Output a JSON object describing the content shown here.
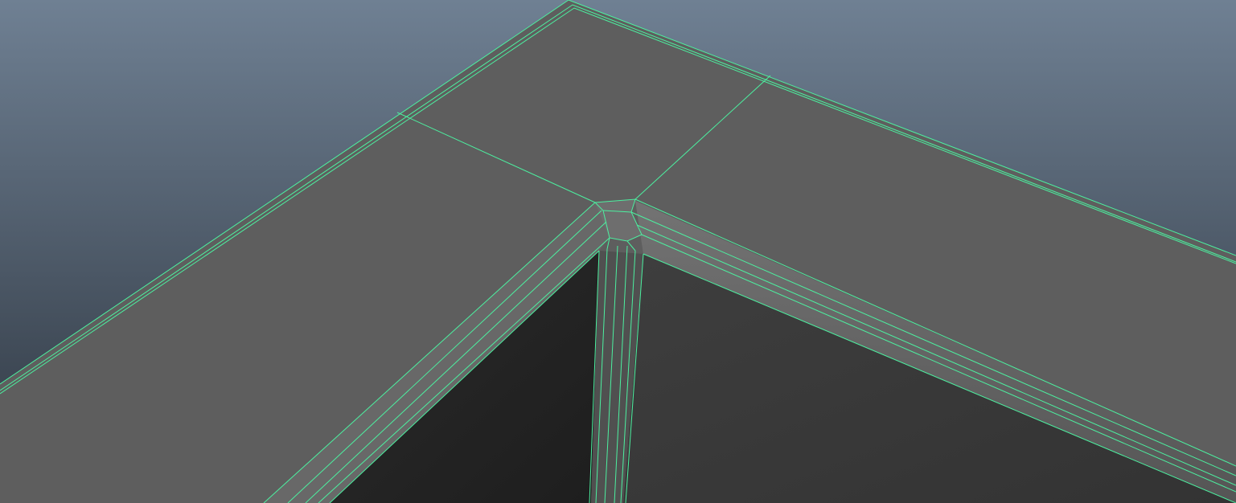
{
  "viewport": {
    "background_top": "#6f8092",
    "background_bottom": "#2e3640",
    "wireframe_color": "#4cf0a0",
    "top_face_color": "#5e5e5e",
    "bevel_color": "#6a6a6a",
    "inner_wall_left_color": "#232323",
    "inner_wall_right_color": "#3a3a3a"
  }
}
